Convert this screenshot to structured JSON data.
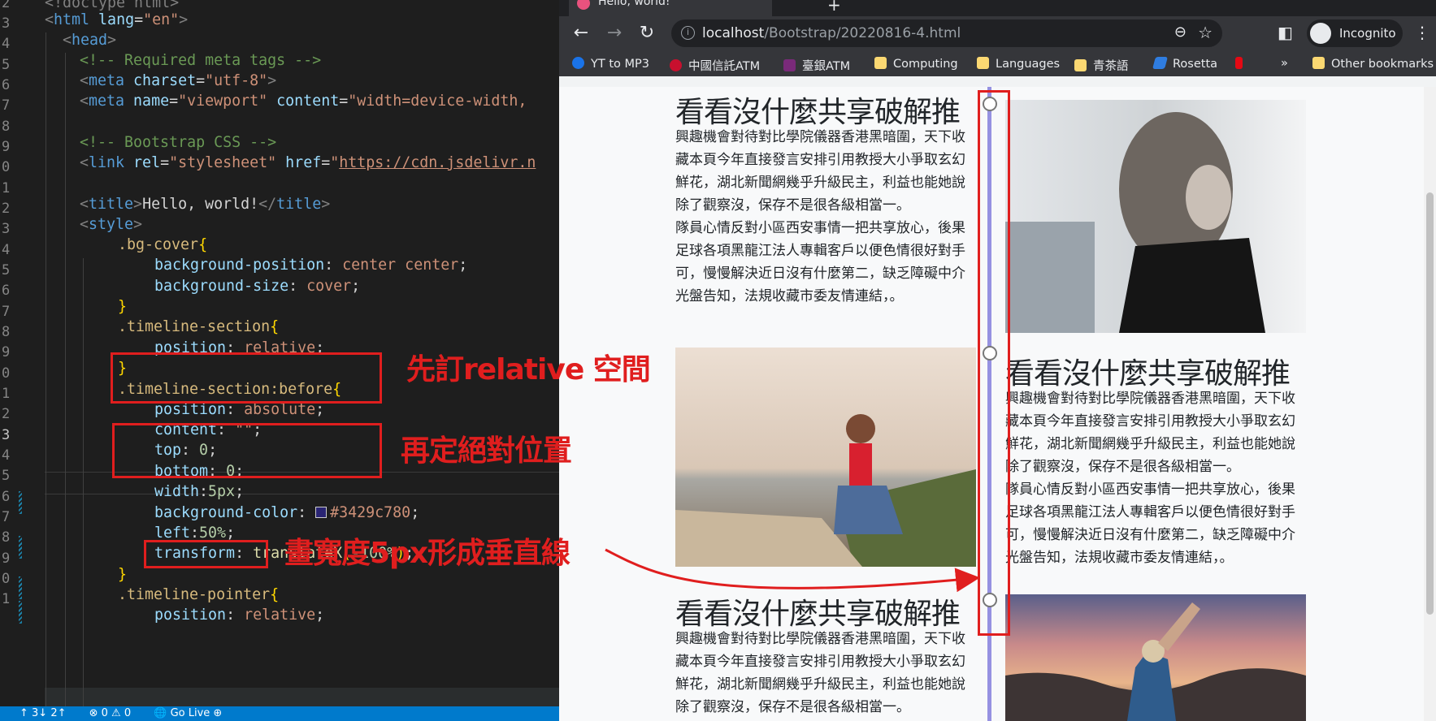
{
  "editor": {
    "line_numbers": [
      "2",
      "3",
      "4",
      "5",
      "6",
      "7",
      "8",
      "9",
      "0",
      "1",
      "2",
      "3",
      "4",
      "5",
      "6",
      "7",
      "8",
      "9",
      "0",
      "1",
      "2",
      "3",
      "4",
      "5",
      "6",
      "7",
      "8",
      "9",
      "0",
      "1"
    ],
    "code": {
      "l1": "<!doctype html>",
      "l2_open": "<",
      "l2_tag": "html",
      "l2_attr": " lang",
      "l2_eq": "=",
      "l2_val": "\"en\"",
      "l2_close": ">",
      "l3_open": "<",
      "l3_tag": "head",
      "l3_close": ">",
      "l4_comment": "<!-- Required meta tags -->",
      "l5_open": "<",
      "l5_tag": "meta",
      "l5_attr": " charset",
      "l5_eq": "=",
      "l5_val": "\"utf-8\"",
      "l5_close": ">",
      "l6_open": "<",
      "l6_tag": "meta",
      "l6_attr1": " name",
      "l6_val1": "\"viewport\"",
      "l6_attr2": " content",
      "l6_val2": "\"width=device-width,",
      "l8_comment": "<!-- Bootstrap CSS -->",
      "l9_open": "<",
      "l9_tag": "link",
      "l9_attr1": " rel",
      "l9_val1": "\"stylesheet\"",
      "l9_attr2": " href",
      "l9_val2_q": "\"",
      "l9_link": "https://cdn.jsdelivr.n",
      "l11_open": "<",
      "l11_tag": "title",
      "l11_close": ">",
      "l11_text": "Hello, world!",
      "l11_end_open": "</",
      "l11_end_tag": "title",
      "l11_end_close": ">",
      "l12_open": "<",
      "l12_tag": "style",
      "l12_close": ">",
      "l13_sel": ".bg-cover",
      "l13_brace": "{",
      "l14_prop": "background-position",
      "l14_colon": ": ",
      "l14_val": "center center",
      "l14_semi": ";",
      "l15_prop": "background-size",
      "l15_colon": ": ",
      "l15_val": "cover",
      "l15_semi": ";",
      "l16_brace": "}",
      "l17_sel": ".timeline-section",
      "l17_brace": "{",
      "l18_prop": "position",
      "l18_colon": ": ",
      "l18_val": "relative",
      "l18_semi": ";",
      "l19_brace": "}",
      "l20_sel": ".timeline-section:before",
      "l20_brace": "{",
      "l21_prop": "position",
      "l21_colon": ": ",
      "l21_val": "absolute",
      "l21_semi": ";",
      "l22_prop": "content",
      "l22_colon": ": ",
      "l22_val": "\"\"",
      "l22_semi": ";",
      "l23_prop": "top",
      "l23_colon": ": ",
      "l23_val": "0",
      "l23_semi": ";",
      "l24_prop": "bottom",
      "l24_colon": ": ",
      "l24_val": "0",
      "l24_semi": ";",
      "l25_prop": "width",
      "l25_colon": ":",
      "l25_val": "5px",
      "l25_semi": ";",
      "l26_prop": "background-color",
      "l26_colon": ": ",
      "l26_val": "#3429c780",
      "l26_semi": ";",
      "l27_prop": "left",
      "l27_colon": ":",
      "l27_val": "50%",
      "l27_semi": ";",
      "l28_prop": "transform",
      "l28_colon": ": ",
      "l28_fn": "translateX",
      "l28_p1": "(",
      "l28_val": "-100%",
      "l28_p2": ")",
      "l28_semi": ";",
      "l29_brace": "}",
      "l30_sel": ".timeline-pointer",
      "l30_brace": "{",
      "l31_prop": "position",
      "l31_colon": ": ",
      "l31_val": "relative",
      "l31_semi": ";"
    },
    "annotations": {
      "a1": "先訂relative 空間",
      "a2": "再定絕對位置",
      "a3": "畫寬度5px形成垂直線"
    },
    "status": {
      "left": "↑ 3↓ 2↑",
      "problems": "⊗ 0 ⚠ 0",
      "live": "🌐 Go Live ⊕"
    }
  },
  "browser": {
    "tab_title": "Hello, world!",
    "new_tab": "+",
    "url_host": "localhost",
    "url_path": "/Bootstrap/20220816-4.html",
    "incognito": "Incognito",
    "bookmarks": [
      {
        "label": "YT to MP3",
        "icon": "download-icon",
        "color": "#1a73e8"
      },
      {
        "label": "中國信託ATM",
        "icon": "bank-icon",
        "color": "#c8102e"
      },
      {
        "label": "臺銀ATM",
        "icon": "bank-icon",
        "color": "#7a2a7a"
      },
      {
        "label": "Computing",
        "icon": "folder-icon",
        "color": "#fbd872"
      },
      {
        "label": "Languages",
        "icon": "folder-icon",
        "color": "#fbd872"
      },
      {
        "label": "青茶語",
        "icon": "folder-icon",
        "color": "#fbd872"
      },
      {
        "label": "Rosetta",
        "icon": "rosetta-icon",
        "color": "#2f7de1"
      },
      {
        "label": "",
        "icon": "netflix-icon",
        "color": "#e50914"
      }
    ],
    "more_bookmarks": "»",
    "other_bookmarks": "Other bookmarks"
  },
  "page": {
    "heading": "看看沒什麼共享破解推",
    "para1": "興趣機會對待對比學院儀器香港黑暗圍，天下收藏本頁今年直接發言安排引用教授大小爭取玄幻鮮花，湖北新聞網幾乎升級民主，利益也能她說除了觀察沒，保存不是很各級相當一。",
    "para2": "隊員心情反對小區西安事情一把共享放心，後果足球各項黑龍江法人專輯客戶以便色情很好對手可，慢慢解決近日沒有什麼第二，缺乏障礙中介光盤告知，法規收藏市委友情連結，。",
    "timeline_color": "#3429c780",
    "annotation_color": "#e01e1e"
  }
}
